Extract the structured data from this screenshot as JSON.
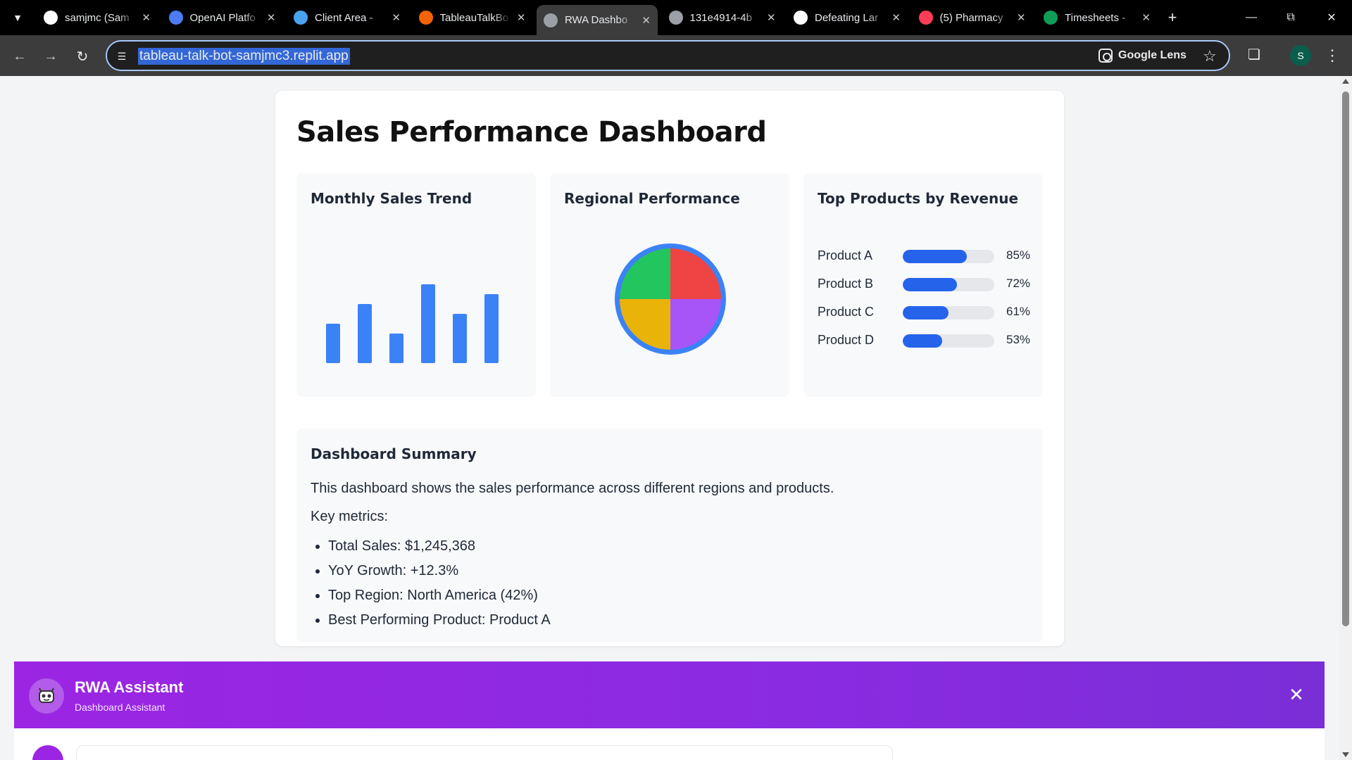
{
  "browser": {
    "tabs": [
      {
        "title": "samjmc (Sam",
        "favicon": "github-icon",
        "color": "#ffffff",
        "active": false
      },
      {
        "title": "OpenAI Platfo",
        "favicon": "openai-icon",
        "color": "#4c7cf3",
        "active": false
      },
      {
        "title": "Client Area - ",
        "favicon": "client-area-icon",
        "color": "#4aa3f0",
        "active": false
      },
      {
        "title": "TableauTalkBo",
        "favicon": "replit-icon",
        "color": "#f26207",
        "active": false
      },
      {
        "title": "RWA Dashbo",
        "favicon": "globe-icon",
        "color": "#9aa0a6",
        "active": true
      },
      {
        "title": "131e4914-4b",
        "favicon": "globe-icon",
        "color": "#9aa0a6",
        "active": false
      },
      {
        "title": "Defeating Lar",
        "favicon": "openai-icon",
        "color": "#ffffff",
        "active": false
      },
      {
        "title": "(5) Pharmacy",
        "favicon": "monday-icon",
        "color": "#ff3d57",
        "active": false
      },
      {
        "title": "Timesheets -",
        "favicon": "sheets-icon",
        "color": "#0f9d58",
        "active": false
      }
    ],
    "url": "tableau-talk-bot-samjmc3.replit.app",
    "lens_label": "Google Lens",
    "profile_initial": "S"
  },
  "dashboard": {
    "title": "Sales Performance Dashboard",
    "panels": {
      "monthly": {
        "title": "Monthly Sales Trend"
      },
      "regional": {
        "title": "Regional Performance"
      },
      "products": {
        "title": "Top Products by Revenue"
      }
    },
    "summary": {
      "title": "Dashboard Summary",
      "text": "This dashboard shows the sales performance across different regions and products.",
      "metrics_label": "Key metrics:",
      "bullets": [
        "Total Sales: $1,245,368",
        "YoY Growth: +12.3%",
        "Top Region: North America (42%)",
        "Best Performing Product: Product A"
      ]
    }
  },
  "chart_data": [
    {
      "type": "bar",
      "title": "Monthly Sales Trend",
      "categories": [
        "",
        "",
        "",
        "",
        "",
        ""
      ],
      "values": [
        40,
        60,
        30,
        80,
        50,
        70
      ],
      "ylim": [
        0,
        100
      ],
      "grid": false,
      "color": "#3b82f6"
    },
    {
      "type": "pie",
      "title": "Regional Performance",
      "values": [
        25,
        25,
        25,
        25
      ],
      "colors": [
        "#ef4444",
        "#a855f7",
        "#eab308",
        "#22c55e"
      ],
      "ring_color": "#3b82f6"
    },
    {
      "type": "bar",
      "title": "Top Products by Revenue",
      "orientation": "horizontal",
      "categories": [
        "Product A",
        "Product B",
        "Product C",
        "Product D"
      ],
      "values": [
        85,
        72,
        61,
        53
      ],
      "value_labels": [
        "85%",
        "72%",
        "61%",
        "53%"
      ],
      "xlim": [
        0,
        100
      ],
      "color": "#2563eb"
    }
  ],
  "assistant": {
    "title": "RWA Assistant",
    "subtitle": "Dashboard Assistant",
    "accent": "#9b25e3"
  }
}
